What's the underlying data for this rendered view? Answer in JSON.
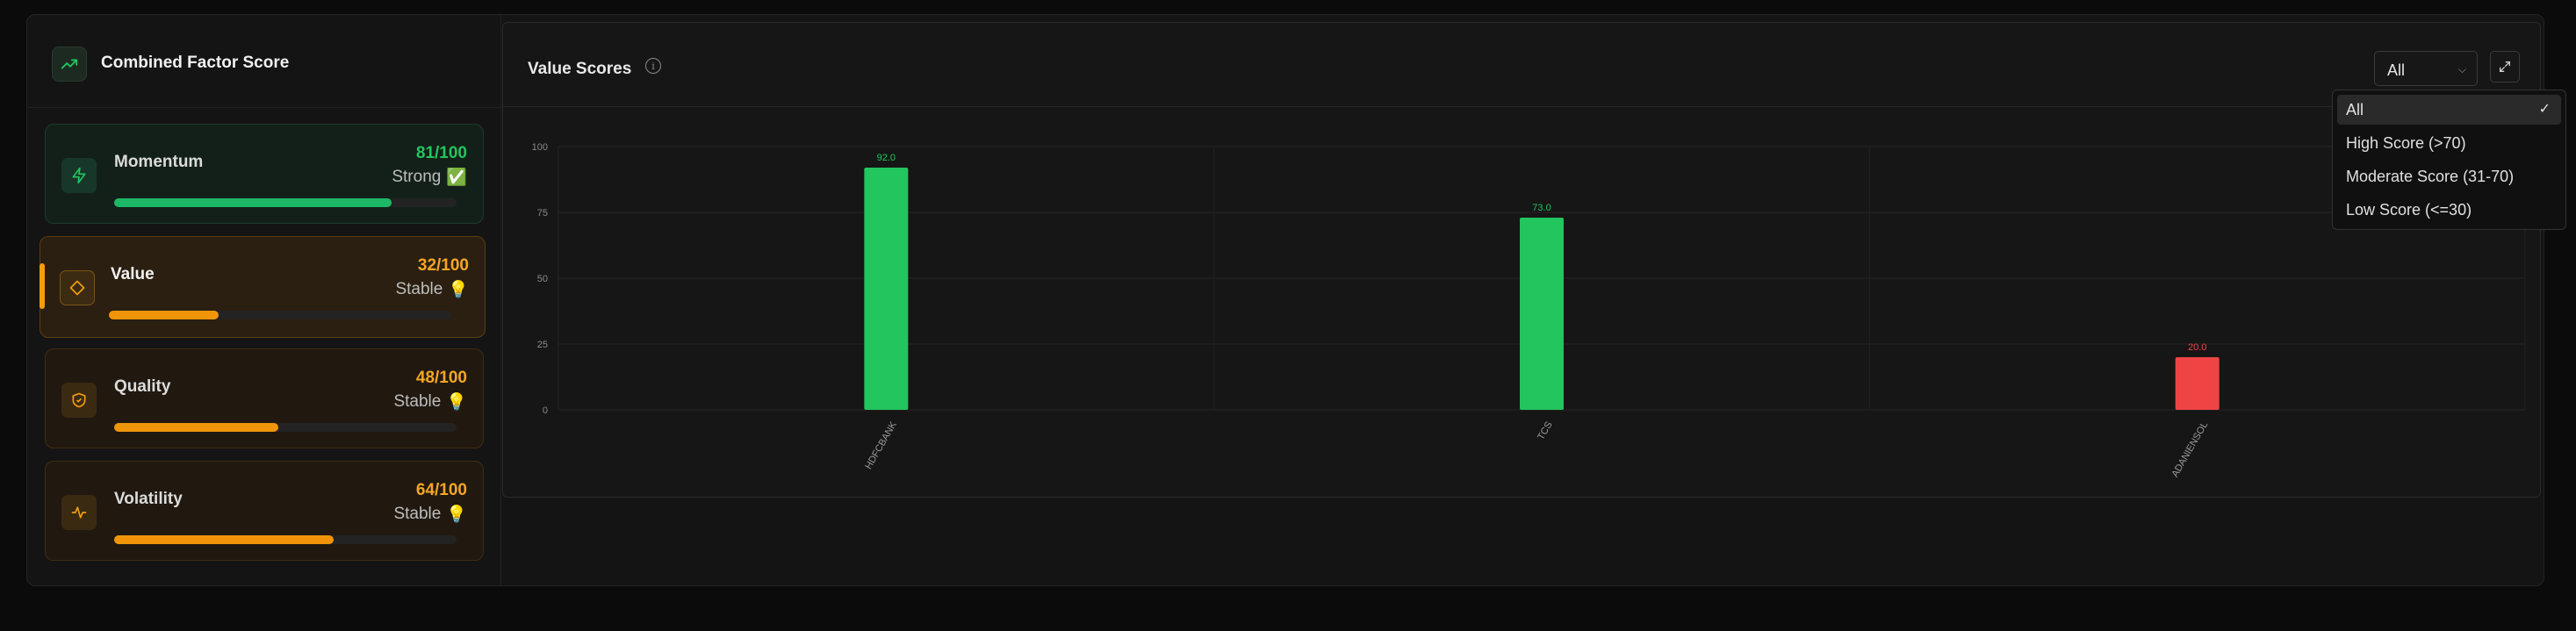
{
  "panel": {
    "title": "Combined Factor Score"
  },
  "factors": [
    {
      "name": "Momentum",
      "score": "81/100",
      "status": "Strong",
      "status_icon": "✅",
      "progress": 0.81,
      "icon": "bolt-icon"
    },
    {
      "name": "Value",
      "score": "32/100",
      "status": "Stable",
      "status_icon": "💡",
      "progress": 0.32,
      "icon": "diamond-icon"
    },
    {
      "name": "Quality",
      "score": "48/100",
      "status": "Stable",
      "status_icon": "💡",
      "progress": 0.48,
      "icon": "shield-icon"
    },
    {
      "name": "Volatility",
      "score": "64/100",
      "status": "Stable",
      "status_icon": "💡",
      "progress": 0.64,
      "icon": "pulse-icon"
    }
  ],
  "chart_panel": {
    "title": "Value Scores",
    "filter_value": "All",
    "dropdown_options": [
      "All",
      "High Score (>70)",
      "Moderate Score (31-70)",
      "Low Score (<=30)"
    ],
    "selected_option": "All"
  },
  "colors": {
    "high": "#22c55e",
    "low": "#ef4444",
    "accent": "#f59e0b"
  },
  "chart_data": {
    "type": "bar",
    "categories": [
      "HDFCBANK",
      "TCS",
      "ADANIENSOL"
    ],
    "values": [
      92.0,
      73.0,
      20.0
    ],
    "data_labels": [
      "92.0",
      "73.0",
      "20.0"
    ],
    "bar_colors": [
      "#22c55e",
      "#22c55e",
      "#ef4444"
    ],
    "ylim": [
      0,
      100
    ],
    "yticks": [
      "0",
      "25",
      "50",
      "75",
      "100"
    ],
    "grid": true
  }
}
